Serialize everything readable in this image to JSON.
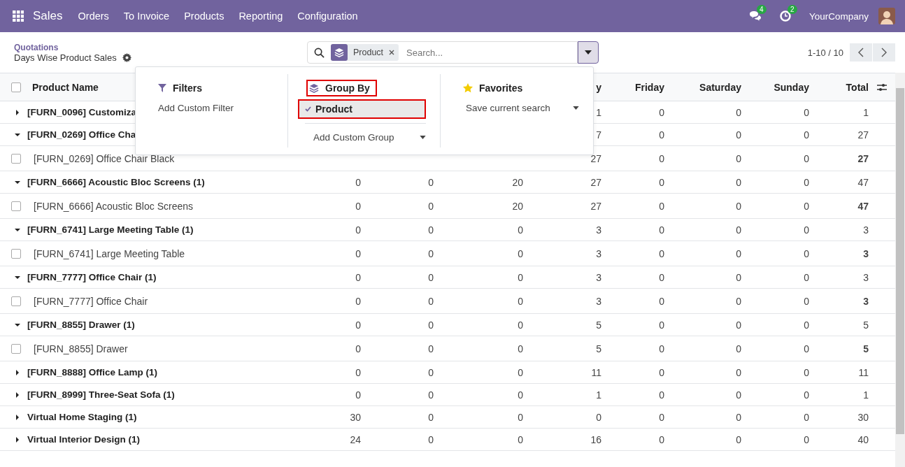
{
  "navbar": {
    "app": "Sales",
    "menu": [
      "Orders",
      "To Invoice",
      "Products",
      "Reporting",
      "Configuration"
    ],
    "messages_badge": "4",
    "activities_badge": "2",
    "company": "YourCompany"
  },
  "breadcrumb": {
    "parent": "Quotations",
    "current": "Days Wise Product Sales"
  },
  "search": {
    "facet": "Product",
    "placeholder": "Search..."
  },
  "pager": {
    "text": "1-10 / 10"
  },
  "dropdown": {
    "sections": [
      {
        "kind": "filters",
        "title": "Filters",
        "highlighted": false,
        "items": [
          {
            "label": "Add Custom Filter",
            "kind": "link"
          }
        ]
      },
      {
        "kind": "groupby",
        "title": "Group By",
        "highlighted": true,
        "items": [
          {
            "label": "Product",
            "kind": "option",
            "selected": true,
            "highlighted": true
          },
          {
            "label": "Add Custom Group",
            "kind": "select"
          }
        ]
      },
      {
        "kind": "favorites",
        "title": "Favorites",
        "highlighted": false,
        "items": [
          {
            "label": "Save current search",
            "kind": "select"
          }
        ]
      }
    ]
  },
  "table": {
    "select_all_checked": false,
    "name_header": "Product Name",
    "columns": [
      "",
      "",
      "",
      "y",
      "Friday",
      "Saturday",
      "Sunday",
      "Total"
    ],
    "rows": [
      {
        "kind": "group",
        "expanded": false,
        "name": "[FURN_0096] Customiza",
        "cells": [
          "",
          "",
          "",
          "1",
          "0",
          "0",
          "0",
          "1"
        ]
      },
      {
        "kind": "group",
        "expanded": true,
        "name": "[FURN_0269] Office Cha",
        "cells": [
          "",
          "",
          "",
          "7",
          "0",
          "0",
          "0",
          "27"
        ]
      },
      {
        "kind": "record",
        "checked": false,
        "name": "[FURN_0269] Office Chair Black",
        "cells": [
          "",
          "",
          "",
          "27",
          "0",
          "0",
          "0",
          "27"
        ]
      },
      {
        "kind": "group",
        "expanded": true,
        "name": "[FURN_6666] Acoustic Bloc Screens (1)",
        "cells": [
          "0",
          "0",
          "20",
          "27",
          "0",
          "0",
          "0",
          "47"
        ]
      },
      {
        "kind": "record",
        "checked": false,
        "name": "[FURN_6666] Acoustic Bloc Screens",
        "cells": [
          "0",
          "0",
          "20",
          "27",
          "0",
          "0",
          "0",
          "47"
        ]
      },
      {
        "kind": "group",
        "expanded": true,
        "name": "[FURN_6741] Large Meeting Table (1)",
        "cells": [
          "0",
          "0",
          "0",
          "3",
          "0",
          "0",
          "0",
          "3"
        ]
      },
      {
        "kind": "record",
        "checked": false,
        "name": "[FURN_6741] Large Meeting Table",
        "cells": [
          "0",
          "0",
          "0",
          "3",
          "0",
          "0",
          "0",
          "3"
        ]
      },
      {
        "kind": "group",
        "expanded": true,
        "name": "[FURN_7777] Office Chair (1)",
        "cells": [
          "0",
          "0",
          "0",
          "3",
          "0",
          "0",
          "0",
          "3"
        ]
      },
      {
        "kind": "record",
        "checked": false,
        "name": "[FURN_7777] Office Chair",
        "cells": [
          "0",
          "0",
          "0",
          "3",
          "0",
          "0",
          "0",
          "3"
        ]
      },
      {
        "kind": "group",
        "expanded": true,
        "name": "[FURN_8855] Drawer (1)",
        "cells": [
          "0",
          "0",
          "0",
          "5",
          "0",
          "0",
          "0",
          "5"
        ]
      },
      {
        "kind": "record",
        "checked": false,
        "name": "[FURN_8855] Drawer",
        "cells": [
          "0",
          "0",
          "0",
          "5",
          "0",
          "0",
          "0",
          "5"
        ]
      },
      {
        "kind": "group",
        "expanded": false,
        "name": "[FURN_8888] Office Lamp (1)",
        "cells": [
          "0",
          "0",
          "0",
          "11",
          "0",
          "0",
          "0",
          "11"
        ]
      },
      {
        "kind": "group",
        "expanded": false,
        "name": "[FURN_8999] Three-Seat Sofa (1)",
        "cells": [
          "0",
          "0",
          "0",
          "1",
          "0",
          "0",
          "0",
          "1"
        ]
      },
      {
        "kind": "group",
        "expanded": false,
        "name": "Virtual Home Staging (1)",
        "cells": [
          "30",
          "0",
          "0",
          "0",
          "0",
          "0",
          "0",
          "30"
        ]
      },
      {
        "kind": "group",
        "expanded": false,
        "name": "Virtual Interior Design (1)",
        "cells": [
          "24",
          "0",
          "0",
          "16",
          "0",
          "0",
          "0",
          "40"
        ]
      }
    ]
  }
}
